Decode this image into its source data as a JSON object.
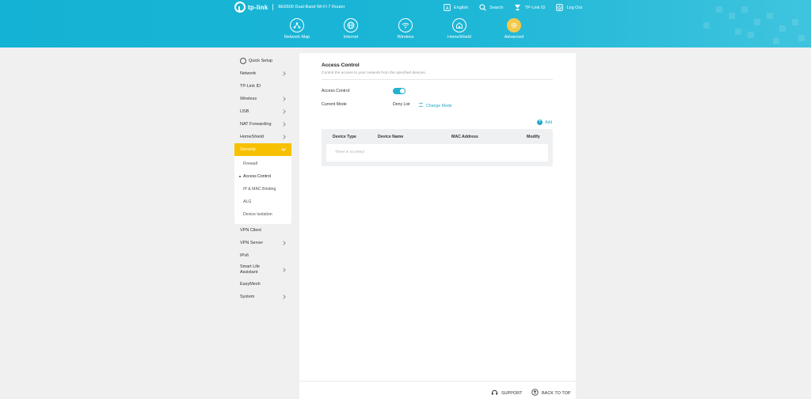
{
  "header": {
    "brand": "tp-link",
    "product": "BE6500 Dual-Band Wi-Fi 7 Router",
    "top_links": [
      {
        "label": "English",
        "icon": "language-icon"
      },
      {
        "label": "Search",
        "icon": "search-icon"
      },
      {
        "label": "TP-Link ID",
        "icon": "tplink-id-icon"
      },
      {
        "label": "Log Out",
        "icon": "logout-icon"
      }
    ],
    "nav": [
      {
        "label": "Network Map",
        "icon": "network-map-icon"
      },
      {
        "label": "Internet",
        "icon": "globe-icon"
      },
      {
        "label": "Wireless",
        "icon": "wifi-icon"
      },
      {
        "label": "HomeShield",
        "icon": "home-shield-icon"
      },
      {
        "label": "Advanced",
        "icon": "gear-icon",
        "active": true
      }
    ]
  },
  "sidebar": {
    "quick_setup": "Quick Setup",
    "items": [
      {
        "label": "Network"
      },
      {
        "label": "TP-Link ID"
      },
      {
        "label": "Wireless"
      },
      {
        "label": "USB"
      },
      {
        "label": "NAT Forwarding"
      },
      {
        "label": "HomeShield"
      },
      {
        "label": "Security"
      }
    ],
    "security_sub": [
      "Firewall",
      "Access Control",
      "IP & MAC Binding",
      "ALG",
      "Device Isolation"
    ],
    "items_after": [
      {
        "label": "VPN Client"
      },
      {
        "label": "VPN Server"
      },
      {
        "label": "IPv6"
      },
      {
        "label": "Smart Life Assistant"
      },
      {
        "label": "EasyMesh"
      },
      {
        "label": "System"
      }
    ]
  },
  "main": {
    "title": "Access Control",
    "description": "Control the access to your network from the specified devices.",
    "access_control_label": "Access Control:",
    "access_control_enabled": true,
    "current_mode_label": "Current Mode",
    "current_mode_value": "Deny List",
    "change_mode": "Change Mode",
    "add": "Add",
    "table": {
      "columns": [
        "Device Type",
        "Device Name",
        "MAC Address",
        "Modify"
      ],
      "empty_text": "There is no entry!"
    }
  },
  "footer": {
    "support": "SUPPORT",
    "back_to_top": "BACK TO TOP"
  },
  "colors": {
    "header": "#1cb6d6",
    "accent": "#23a9cc",
    "active_menu": "#f7c000"
  }
}
